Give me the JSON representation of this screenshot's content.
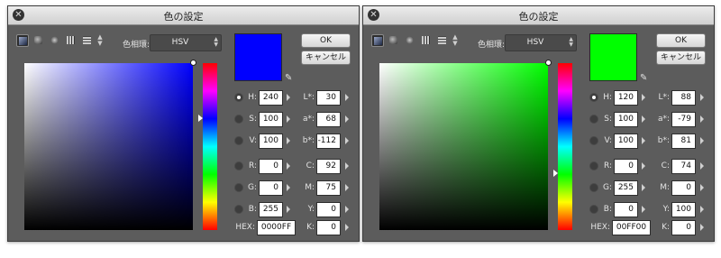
{
  "dialogs": [
    {
      "title": "色の設定",
      "color_space_label": "色相環:",
      "color_space_value": "HSV",
      "current_color": "#0000ff",
      "hue_hex": "#0000ff",
      "buttons": {
        "ok": "OK",
        "cancel": "キャンセル"
      },
      "selected_radio": "H",
      "fields": {
        "h": {
          "label": "H:",
          "value": "240"
        },
        "s": {
          "label": "S:",
          "value": "100"
        },
        "v": {
          "label": "V:",
          "value": "100"
        },
        "r": {
          "label": "R:",
          "value": "0"
        },
        "g": {
          "label": "G:",
          "value": "0"
        },
        "b": {
          "label": "B:",
          "value": "255"
        },
        "hex": {
          "label": "HEX:",
          "value": "0000FF"
        },
        "l": {
          "label": "L*:",
          "value": "30"
        },
        "a": {
          "label": "a*:",
          "value": "68"
        },
        "bb": {
          "label": "b*:",
          "value": "-112"
        },
        "c": {
          "label": "C:",
          "value": "92"
        },
        "m": {
          "label": "M:",
          "value": "75"
        },
        "y": {
          "label": "Y:",
          "value": "0"
        },
        "k": {
          "label": "K:",
          "value": "0"
        }
      }
    },
    {
      "title": "色の設定",
      "color_space_label": "色相環:",
      "color_space_value": "HSV",
      "current_color": "#00ff00",
      "hue_hex": "#00ff00",
      "buttons": {
        "ok": "OK",
        "cancel": "キャンセル"
      },
      "selected_radio": "H",
      "fields": {
        "h": {
          "label": "H:",
          "value": "120"
        },
        "s": {
          "label": "S:",
          "value": "100"
        },
        "v": {
          "label": "V:",
          "value": "100"
        },
        "r": {
          "label": "R:",
          "value": "0"
        },
        "g": {
          "label": "G:",
          "value": "255"
        },
        "b": {
          "label": "B:",
          "value": "0"
        },
        "hex": {
          "label": "HEX:",
          "value": "00FF00"
        },
        "l": {
          "label": "L*:",
          "value": "88"
        },
        "a": {
          "label": "a*:",
          "value": "-79"
        },
        "bb": {
          "label": "b*:",
          "value": "81"
        },
        "c": {
          "label": "C:",
          "value": "74"
        },
        "m": {
          "label": "M:",
          "value": "0"
        },
        "y": {
          "label": "Y:",
          "value": "100"
        },
        "k": {
          "label": "K:",
          "value": "0"
        }
      }
    }
  ],
  "icons": {
    "close": "close-icon",
    "eyedropper": "eyedropper-icon",
    "modes": [
      "square-picker-icon",
      "circle-picker-icon",
      "wheel-picker-icon",
      "grid-picker-icon",
      "strip-picker-icon"
    ]
  }
}
